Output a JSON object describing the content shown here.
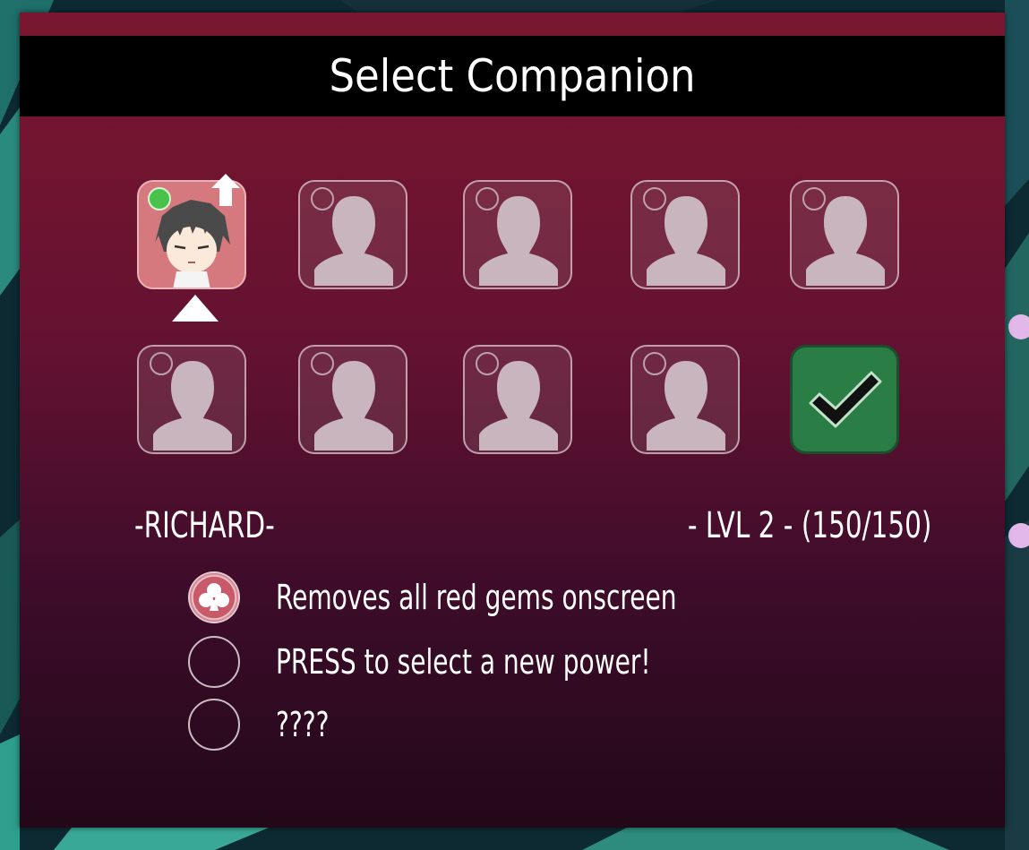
{
  "title": "Select Companion",
  "companion": {
    "name": "-RICHARD-",
    "level": "- LVL 2 - (150/150)"
  },
  "slots": [
    {
      "state": "selected",
      "icon": "richard-portrait"
    },
    {
      "state": "locked",
      "icon": "silhouette-icon"
    },
    {
      "state": "locked",
      "icon": "silhouette-icon"
    },
    {
      "state": "locked",
      "icon": "silhouette-icon"
    },
    {
      "state": "locked",
      "icon": "silhouette-icon"
    },
    {
      "state": "locked",
      "icon": "silhouette-icon"
    },
    {
      "state": "locked",
      "icon": "silhouette-icon"
    },
    {
      "state": "locked",
      "icon": "silhouette-icon"
    },
    {
      "state": "locked",
      "icon": "silhouette-icon"
    },
    {
      "state": "confirm",
      "icon": "checkmark-icon"
    }
  ],
  "powers": [
    {
      "label": "Removes all red gems onscreen",
      "icon": "club-icon"
    },
    {
      "label": "PRESS to select a new power!",
      "icon": "empty-circle"
    },
    {
      "label": "????",
      "icon": "empty-circle"
    }
  ],
  "colors": {
    "panel_top": "#7a1630",
    "panel_bottom": "#220818",
    "confirm_green": "#2a7d45",
    "selected_slot": "#d6797e",
    "status_dot": "#48c24a"
  }
}
